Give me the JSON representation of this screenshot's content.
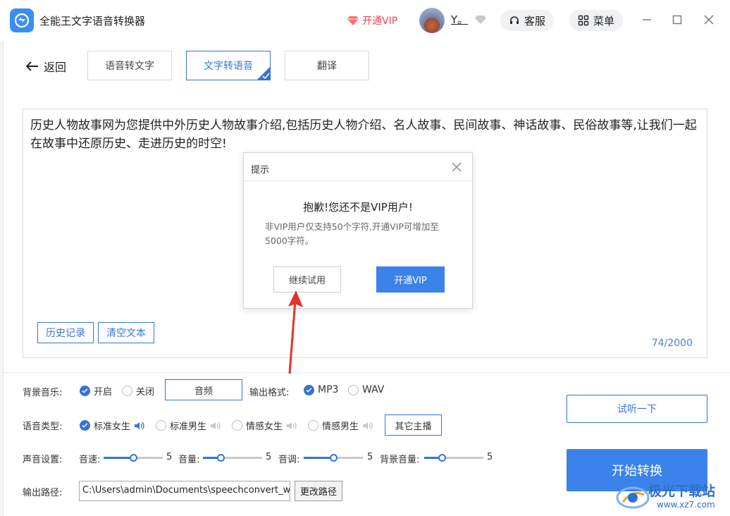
{
  "app": {
    "title": "全能王文字语音转换器"
  },
  "header": {
    "vip_label": "开通VIP",
    "username": "Y。",
    "service_label": "客服",
    "menu_label": "菜单"
  },
  "nav": {
    "back_label": "返回",
    "tabs": [
      {
        "label": "语音转文字",
        "active": false
      },
      {
        "label": "文字转语音",
        "active": true
      },
      {
        "label": "翻译",
        "active": false
      }
    ]
  },
  "editor": {
    "text": "历史人物故事网为您提供中外历史人物故事介绍,包括历史人物介绍、名人故事、民间故事、神话故事、民俗故事等,让我们一起在故事中还原历史、走进历史的时空!",
    "history_label": "历史记录",
    "clear_label": "清空文本",
    "char_count": "74/2000"
  },
  "settings": {
    "bgm_label": "背景音乐:",
    "bgm_on": "开启",
    "bgm_off": "关闭",
    "audio_btn": "音频",
    "format_label": "输出格式:",
    "format_mp3": "MP3",
    "format_wav": "WAV",
    "voice_label": "语音类型:",
    "voices": [
      "标准女生",
      "标准男生",
      "情感女生",
      "情感男生"
    ],
    "other_voice_btn": "其它主播",
    "sound_label": "声音设置:",
    "sliders": [
      {
        "label": "音速:",
        "value": "5",
        "level": 0.5
      },
      {
        "label": "音量:",
        "value": "5",
        "level": 0.3
      },
      {
        "label": "音调:",
        "value": "5",
        "level": 0.5
      },
      {
        "label": "背景音量:",
        "value": "5",
        "level": 0.3
      }
    ],
    "path_label": "输出路径:",
    "path_value": "C:\\Users\\admin\\Documents\\speechconvert_w",
    "change_path_btn": "更改路径",
    "listen_btn": "试听一下",
    "start_btn": "开始转换"
  },
  "modal": {
    "title": "提示",
    "heading": "抱歉!您还不是VIP用户!",
    "message": "非VIP用户仅支持50个字符,开通VIP可增加至5000字符。",
    "continue_btn": "继续试用",
    "vip_btn": "开通VIP"
  },
  "watermark": {
    "text": "极光下载站",
    "url": "www.xz7.com"
  },
  "colors": {
    "accent": "#3574d6",
    "primary_button": "#3b82ea",
    "vip": "#e9435a",
    "annotation_arrow": "#e8302a"
  }
}
